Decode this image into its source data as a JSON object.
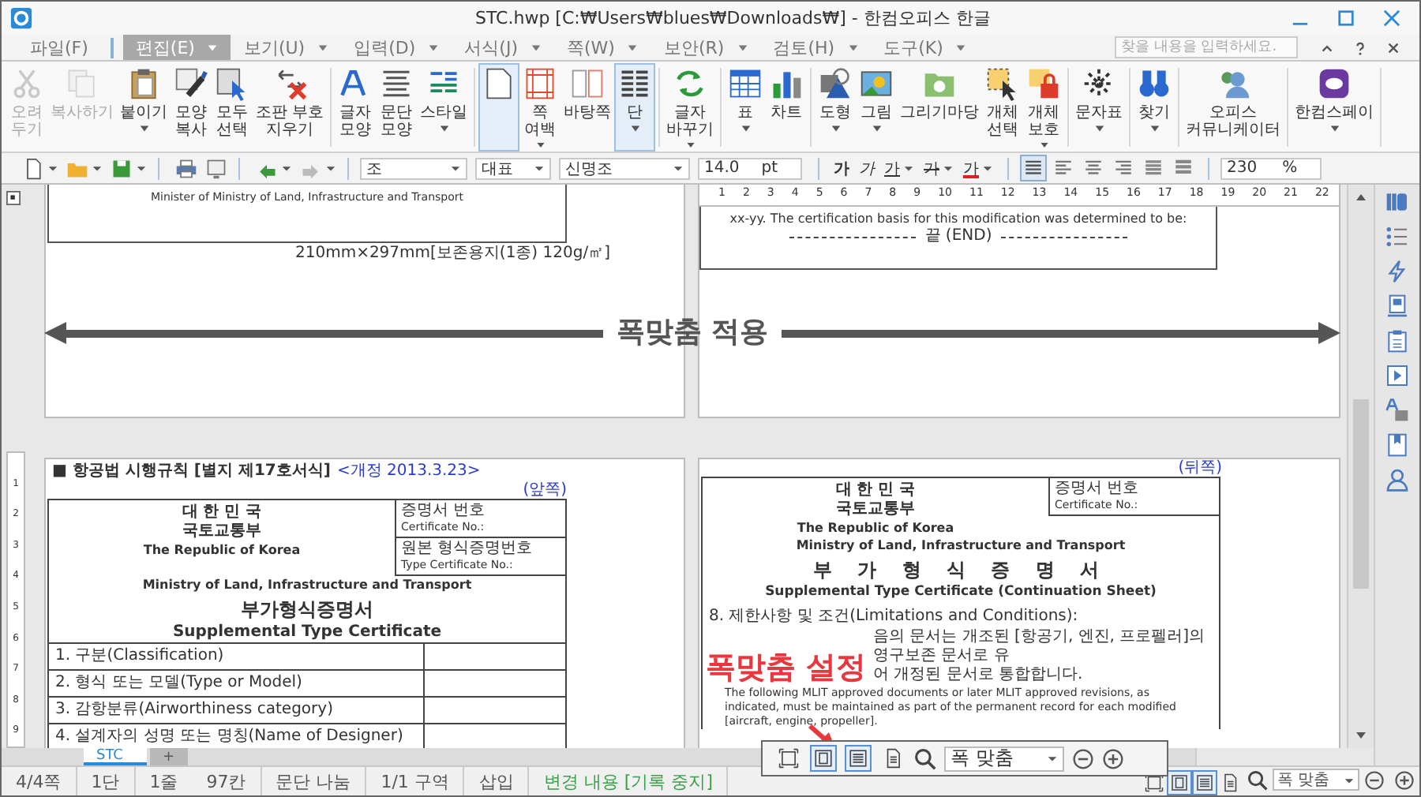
{
  "window": {
    "title": "STC.hwp [C:₩Users₩blues₩Downloads₩] - 한컴오피스 한글"
  },
  "menu": {
    "items": [
      {
        "label": "파일(F)",
        "selected": false,
        "caret": false
      },
      {
        "label": "편집(E)",
        "selected": true,
        "caret": true
      },
      {
        "label": "보기(U)",
        "selected": false,
        "caret": true
      },
      {
        "label": "입력(D)",
        "selected": false,
        "caret": true
      },
      {
        "label": "서식(J)",
        "selected": false,
        "caret": true
      },
      {
        "label": "쪽(W)",
        "selected": false,
        "caret": true
      },
      {
        "label": "보안(R)",
        "selected": false,
        "caret": true
      },
      {
        "label": "검토(H)",
        "selected": false,
        "caret": true
      },
      {
        "label": "도구(K)",
        "selected": false,
        "caret": true
      }
    ],
    "search": {
      "placeholder": "찾을 내용을 입력하세요."
    }
  },
  "ribbon": {
    "groups": [
      {
        "buttons": [
          {
            "label": "오려\n두기",
            "disabled": true,
            "selected": false,
            "caret": false
          },
          {
            "label": "복사하기",
            "disabled": true,
            "selected": false,
            "caret": false
          },
          {
            "label": "붙이기",
            "disabled": false,
            "selected": false,
            "caret": true
          },
          {
            "label": "모양\n복사",
            "disabled": false,
            "selected": false,
            "caret": false
          },
          {
            "label": "모두\n선택",
            "disabled": false,
            "selected": false,
            "caret": false
          },
          {
            "label": "조판 부호\n지우기",
            "disabled": false,
            "selected": false,
            "caret": false
          }
        ]
      },
      {
        "buttons": [
          {
            "label": "글자\n모양",
            "disabled": false,
            "selected": false,
            "caret": false
          },
          {
            "label": "문단\n모양",
            "disabled": false,
            "selected": false,
            "caret": false
          },
          {
            "label": "스타일",
            "disabled": false,
            "selected": false,
            "caret": true
          }
        ]
      },
      {
        "buttons": [
          {
            "disabled": false,
            "selected": true,
            "caret": false
          },
          {
            "label": "쪽\n여백",
            "disabled": false,
            "selected": false,
            "caret": true
          },
          {
            "label": "바탕쪽",
            "disabled": false,
            "selected": false,
            "caret": false
          },
          {
            "label": "단",
            "disabled": false,
            "selected": true,
            "caret": true
          }
        ]
      },
      {
        "buttons": [
          {
            "label": "글자\n바꾸기",
            "disabled": false,
            "selected": false,
            "caret": true
          }
        ]
      },
      {
        "buttons": [
          {
            "label": "표",
            "disabled": false,
            "selected": false,
            "caret": true
          },
          {
            "label": "차트",
            "disabled": false,
            "selected": false,
            "caret": false
          }
        ]
      },
      {
        "buttons": [
          {
            "label": "도형",
            "disabled": false,
            "selected": false,
            "caret": true
          },
          {
            "label": "그림",
            "disabled": false,
            "selected": false,
            "caret": true
          },
          {
            "label": "그리기마당",
            "disabled": false,
            "selected": false,
            "caret": false
          },
          {
            "label": "개체\n선택",
            "disabled": false,
            "selected": false,
            "caret": false
          },
          {
            "label": "개체\n보호",
            "disabled": false,
            "selected": false,
            "caret": true
          }
        ]
      },
      {
        "buttons": [
          {
            "label": "문자표",
            "disabled": false,
            "selected": false,
            "caret": true
          }
        ]
      },
      {
        "buttons": [
          {
            "label": "찾기",
            "disabled": false,
            "selected": false,
            "caret": true
          }
        ]
      },
      {
        "buttons": [
          {
            "label": "오피스\n커뮤니케이터",
            "disabled": false,
            "selected": false,
            "caret": false
          }
        ]
      },
      {
        "buttons": [
          {
            "label": "한컴스페이",
            "disabled": false,
            "selected": false,
            "caret": true
          }
        ]
      }
    ]
  },
  "format_bar": {
    "style": "조",
    "language": "대표",
    "font": "신명조",
    "size": "14.0",
    "unit": "pt",
    "char_buttons": [
      {
        "label": "가",
        "kind": "bold",
        "caret": false
      },
      {
        "label": "가",
        "kind": "italic",
        "caret": false
      },
      {
        "label": "가",
        "kind": "underline",
        "caret": true
      },
      {
        "label": "가",
        "kind": "strike",
        "caret": true
      },
      {
        "label": "가",
        "kind": "color",
        "caret": true
      }
    ],
    "align_buttons": [
      {
        "selected": true
      },
      {
        "selected": false
      },
      {
        "selected": false
      },
      {
        "selected": false
      },
      {
        "selected": false
      },
      {
        "selected": false
      }
    ],
    "ratio": "230",
    "ratio_unit": "%"
  },
  "pages": {
    "top_left": {
      "text": "Minister of Ministry of Land, Infrastructure and Transport",
      "footer": "210mm×297mm[보존용지(1종) 120g/㎡]"
    },
    "top_right": {
      "ruler": [
        "1",
        "2",
        "3",
        "4",
        "5",
        "6",
        "7",
        "8",
        "9",
        "10",
        "11",
        "12",
        "13",
        "14",
        "15",
        "16",
        "17",
        "18",
        "19",
        "20",
        "21",
        "22"
      ],
      "text": "xx-yy. The certification basis for this modification was determined to be:",
      "end_mark": "끝 (END)"
    },
    "bottom_left": {
      "header": "■ 항공법 시행규칙 [별지 제17호서식]",
      "revision": "<개정 2013.3.23>",
      "page_side": "(앞쪽)",
      "country": "대 한 민 국",
      "ministry": "국토교통부",
      "country_en": "The Republic of Korea",
      "ministry_en": "Ministry of Land, Infrastructure and Transport",
      "fields": [
        {
          "label": "증명서 번호",
          "label_en": "Certificate No.:"
        },
        {
          "label": "원본 형식증명번호",
          "label_en": "Type Certificate No.:"
        }
      ],
      "title": "부가형식증명서",
      "title_en": "Supplemental Type Certificate",
      "rows": [
        "1. 구분(Classification)",
        "2. 형식 또는 모델(Type or Model)",
        "3. 감항분류(Airworthiness category)",
        "4. 설계자의 성명 또는 명칭(Name of Designer)"
      ]
    },
    "bottom_right": {
      "page_side": "(뒤쪽)",
      "country": "대 한 민 국",
      "ministry": "국토교통부",
      "country_en": "The Republic of Korea",
      "ministry_en": "Ministry of Land, Infrastructure and Transport",
      "fields": [
        {
          "label": "증명서 번호",
          "label_en": "Certificate No.:"
        }
      ],
      "title": "부 가 형 식 증 명 서",
      "title_en": "Supplemental Type Certificate (Continuation Sheet)",
      "section": "8. 제한사항 및 조건(Limitations and Conditions):",
      "ko_lines": [
        "음의 문서는 개조된 [항공기, 엔진, 프로펠러]의 영구보존 문서로 유",
        "어 개정된 문서로 통합합니다."
      ],
      "en_text": "The following MLIT approved documents or later MLIT approved revisions, as indicated, must be maintained as part of the permanent record for each modified [aircraft, engine, propeller]."
    }
  },
  "vertical_ruler": [
    "1",
    "2",
    "3",
    "4",
    "5",
    "6",
    "7",
    "8",
    "9"
  ],
  "doc_tabs": [
    {
      "label": "STC",
      "selected": true
    },
    {
      "label": "+",
      "selected": false
    }
  ],
  "annotations": {
    "apply": "폭맞춤 적용",
    "setting": "폭맞춤 설정"
  },
  "floating_zoom": {
    "view_buttons": [
      {
        "selected": false
      },
      {
        "selected": true
      },
      {
        "selected": true
      },
      {
        "selected": false
      }
    ],
    "zoom": "폭 맞춤"
  },
  "status_bar": {
    "cells": [
      {
        "texts": [
          "4/4쪽"
        ],
        "kind": "plain"
      },
      {
        "texts": [
          "1단"
        ],
        "kind": "plain"
      },
      {
        "texts": [
          "1줄",
          "97칸"
        ],
        "kind": "plain"
      },
      {
        "texts": [
          "문단 나눔"
        ],
        "kind": "plain"
      },
      {
        "texts": [
          "1/1 구역"
        ],
        "kind": "plain"
      },
      {
        "texts": [
          "삽입"
        ],
        "kind": "plain"
      },
      {
        "texts": [
          "변경 내용 [기록 중지]"
        ],
        "kind": "track"
      }
    ],
    "view_buttons": [
      {
        "selected": false
      },
      {
        "selected": true
      },
      {
        "selected": true
      },
      {
        "selected": false
      }
    ],
    "zoom": "폭 맞춤"
  }
}
